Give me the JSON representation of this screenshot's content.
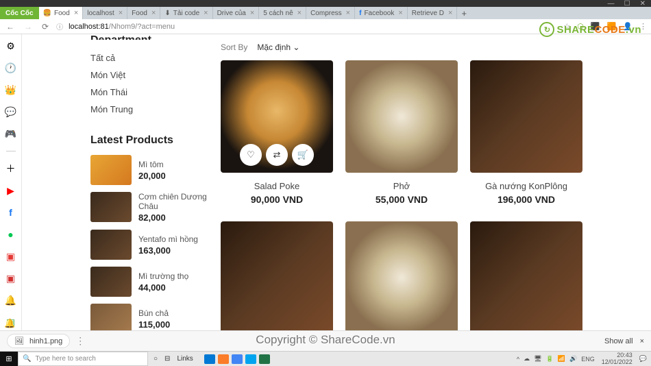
{
  "window": {
    "buttons": [
      "—",
      "☐",
      "✕"
    ]
  },
  "browser": {
    "name": "Cốc Cốc",
    "tabs": [
      {
        "icon": "🍔",
        "title": "Food",
        "active": true
      },
      {
        "icon": "",
        "title": "localhost"
      },
      {
        "icon": "",
        "title": "Food"
      },
      {
        "icon": "⬇",
        "title": "Tải code"
      },
      {
        "icon": "",
        "title": "Drive của"
      },
      {
        "icon": "",
        "title": "5 cách nê"
      },
      {
        "icon": "",
        "title": "Compress"
      },
      {
        "icon": "f",
        "title": "Facebook"
      },
      {
        "icon": "",
        "title": "Retrieve D"
      }
    ],
    "url_host": "localhost:81",
    "url_path": "/Nhom9/?act=menu"
  },
  "leftbar_icons": [
    "⚙",
    "⏱",
    "👑",
    "💬",
    "🎮",
    "＋",
    "▶",
    "f",
    "🟢",
    "📕",
    "📗",
    "🔔",
    "🟩"
  ],
  "page": {
    "department_heading": "Department",
    "categories": [
      "Tất cả",
      "Món Việt",
      "Món Thái",
      "Món Trung"
    ],
    "latest_heading": "Latest Products",
    "latest": [
      {
        "name": "Mì tôm",
        "price": "20,000",
        "thumb": "noodle"
      },
      {
        "name": "Cơm chiên Dương Châu",
        "price": "82,000",
        "thumb": "steak"
      },
      {
        "name": "Yentafo mì hồng",
        "price": "163,000",
        "thumb": "steak"
      },
      {
        "name": "Mì trường thọ",
        "price": "44,000",
        "thumb": "steak"
      },
      {
        "name": "Bún chả",
        "price": "115,000",
        "thumb": "soup"
      }
    ],
    "sort_label": "Sort By",
    "sort_value": "Mặc định",
    "products": [
      {
        "name": "Salad Poke",
        "price": "90,000 VND",
        "img": "burger",
        "hover": true
      },
      {
        "name": "Phở",
        "price": "55,000 VND",
        "img": "pho"
      },
      {
        "name": "Gà nướng KonPlông",
        "price": "196,000 VND",
        "img": "steak"
      }
    ],
    "products_row2": [
      {
        "img": "steak"
      },
      {
        "img": "pho"
      },
      {
        "img": "steak"
      }
    ]
  },
  "watermarks": {
    "logo_text_1": "SHARE",
    "logo_text_2": "CODE",
    "logo_suffix": ".vn",
    "center": "ShareCode.vn",
    "copyright": "Copyright © ShareCode.vn"
  },
  "download": {
    "file": "hinh1.png",
    "showall": "Show all"
  },
  "taskbar": {
    "search_placeholder": "Type here to search",
    "links": "Links",
    "lang": "ENG",
    "time": "20:43",
    "date": "12/01/2022"
  }
}
